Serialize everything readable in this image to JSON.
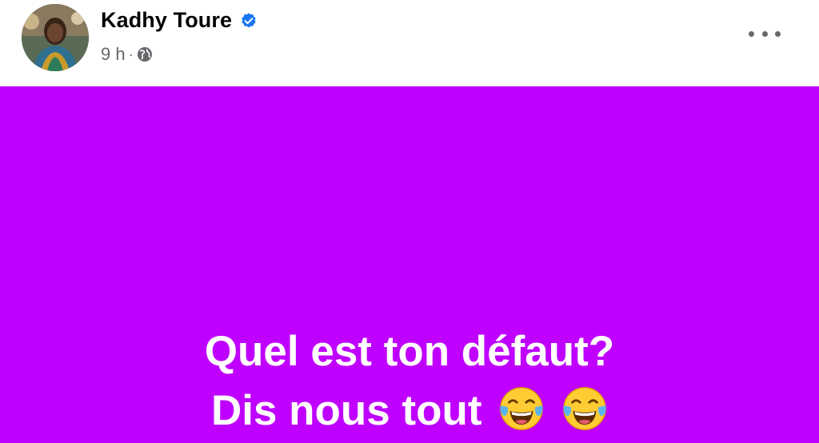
{
  "author": {
    "name": "Kadhy Toure",
    "timestamp": "9 h",
    "separator": "·"
  },
  "icons": {
    "verified": "verified-badge-icon",
    "audience": "globe-icon",
    "menu": "more-options-icon",
    "emoji": "tears-of-joy-emoji"
  },
  "post": {
    "background_color": "#bf00ff",
    "line1": "Quel est ton défaut?",
    "line2": "Dis nous tout"
  },
  "colors": {
    "verified": "#1877f2",
    "meta_text": "#65676b"
  }
}
